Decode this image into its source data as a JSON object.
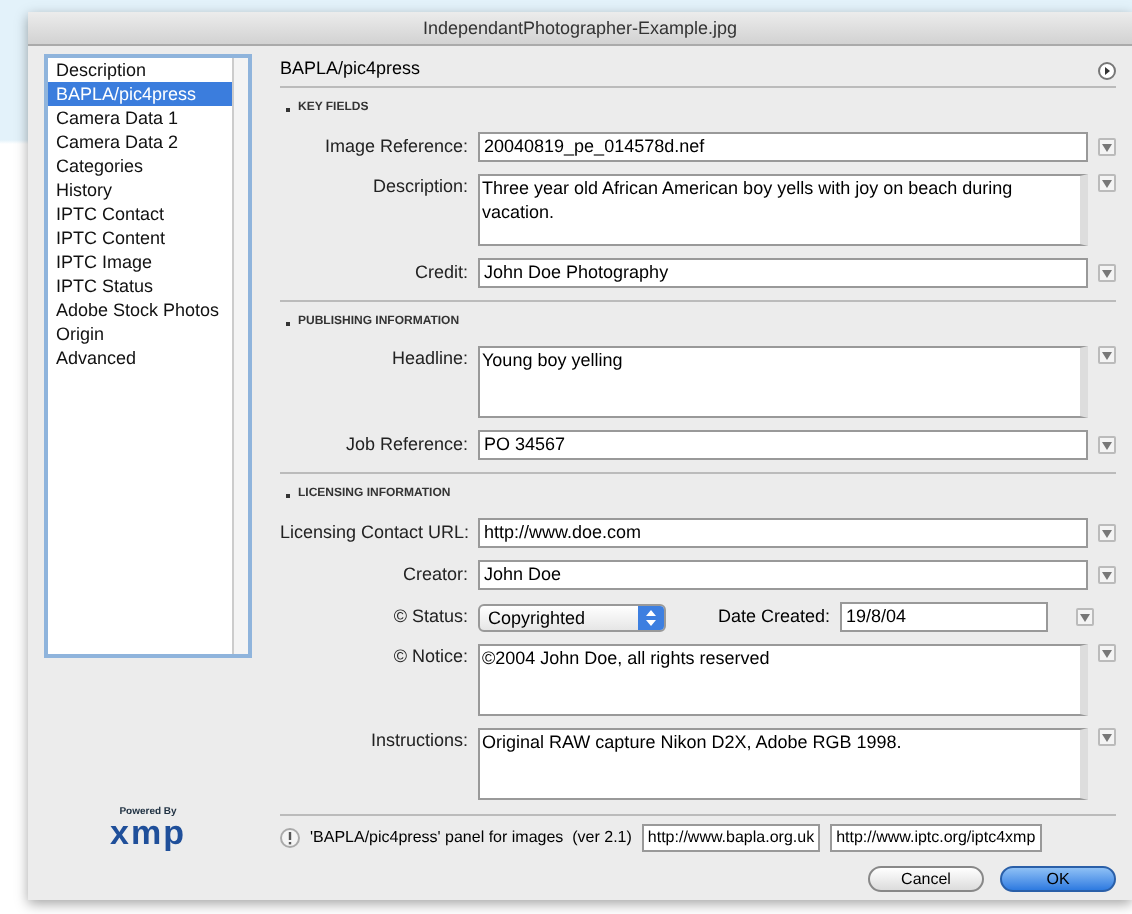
{
  "window": {
    "title": "IndependantPhotographer-Example.jpg"
  },
  "sidebar": {
    "items": [
      {
        "label": "Description",
        "selected": false
      },
      {
        "label": "BAPLA/pic4press",
        "selected": true
      },
      {
        "label": "Camera Data 1",
        "selected": false
      },
      {
        "label": "Camera Data 2",
        "selected": false
      },
      {
        "label": "Categories",
        "selected": false
      },
      {
        "label": "History",
        "selected": false
      },
      {
        "label": "IPTC Contact",
        "selected": false
      },
      {
        "label": "IPTC Content",
        "selected": false
      },
      {
        "label": "IPTC Image",
        "selected": false
      },
      {
        "label": "IPTC Status",
        "selected": false
      },
      {
        "label": "Adobe Stock Photos",
        "selected": false
      },
      {
        "label": "Origin",
        "selected": false
      },
      {
        "label": "Advanced",
        "selected": false
      }
    ]
  },
  "panel": {
    "title": "BAPLA/pic4press",
    "sections": [
      {
        "title": "KEY FIELDS",
        "fields": [
          {
            "kind": "line",
            "label": "Image Reference:",
            "value": "20040819_pe_014578d.nef"
          },
          {
            "kind": "area",
            "label": "Description:",
            "value": "Three year old African American boy yells with joy on beach during vacation."
          },
          {
            "kind": "line",
            "label": "Credit:",
            "value": "John Doe Photography"
          }
        ]
      },
      {
        "title": "PUBLISHING INFORMATION",
        "fields": [
          {
            "kind": "area",
            "label": "Headline:",
            "value": "Young boy yelling"
          },
          {
            "kind": "line",
            "label": "Job Reference:",
            "value": "PO 34567"
          }
        ]
      },
      {
        "title": "LICENSING INFORMATION",
        "fields": [
          {
            "kind": "line",
            "label": "Licensing Contact URL:",
            "value": "http://www.doe.com"
          },
          {
            "kind": "line",
            "label": "Creator:",
            "value": "John Doe"
          },
          {
            "kind": "status",
            "label": "© Status:",
            "value": "Copyrighted",
            "date_label": "Date Created:",
            "date_value": "19/8/04"
          },
          {
            "kind": "area",
            "label": "© Notice:",
            "value": "©2004 John Doe, all rights reserved"
          },
          {
            "kind": "area",
            "label": "Instructions:",
            "value": "Original RAW capture Nikon D2X, Adobe RGB 1998."
          }
        ]
      }
    ]
  },
  "footer": {
    "logo_caption": "Powered By",
    "logo": "xmp",
    "info": "'BAPLA/pic4press' panel for images  (ver 2.1)",
    "urls": [
      "http://www.bapla.org.uk",
      "http://www.iptc.org/iptc4xmp"
    ]
  },
  "buttons": [
    {
      "label": "Cancel",
      "default": false
    },
    {
      "label": "OK",
      "default": true
    }
  ]
}
